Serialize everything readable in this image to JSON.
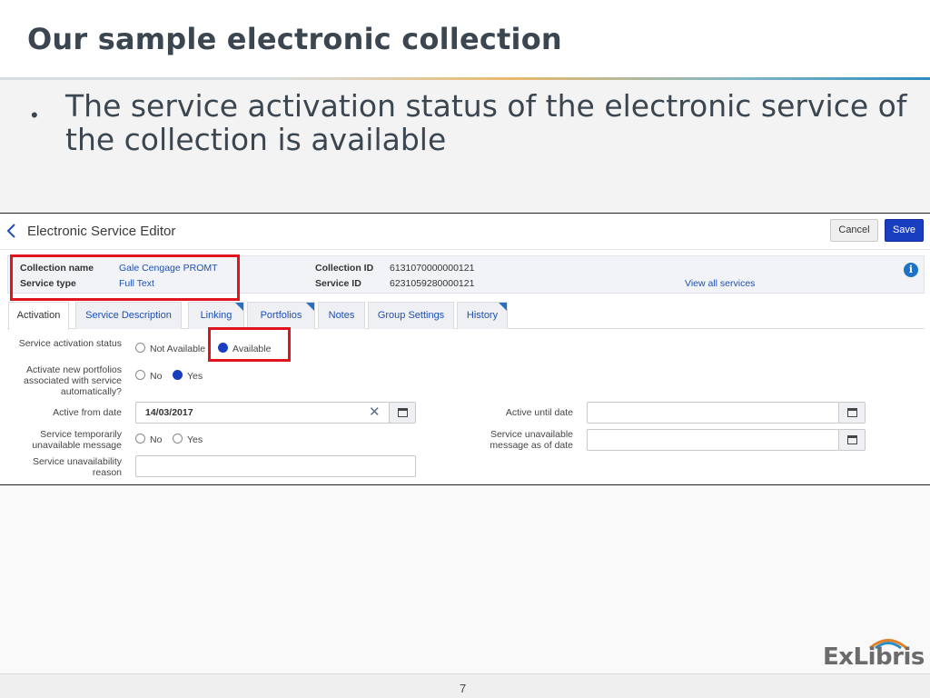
{
  "slide": {
    "title": "Our sample electronic collection",
    "bullet": "The service activation status of the electronic service of the collection is available",
    "page_number": "7",
    "logo_text": "ExLibris"
  },
  "editor": {
    "title": "Electronic Service Editor",
    "cancel_label": "Cancel",
    "save_label": "Save",
    "info": {
      "collection_name_label": "Collection name",
      "collection_name_value": "Gale Cengage PROMT",
      "service_type_label": "Service type",
      "service_type_value": "Full Text",
      "collection_id_label": "Collection ID",
      "collection_id_value": "6131070000000121",
      "service_id_label": "Service ID",
      "service_id_value": "6231059280000121",
      "view_all_link": "View all services",
      "info_icon": "i"
    },
    "tabs": [
      {
        "label": "Activation",
        "active": true
      },
      {
        "label": "Service Description",
        "active": false
      },
      {
        "label": "Linking",
        "active": false
      },
      {
        "label": "Portfolios",
        "active": false
      },
      {
        "label": "Notes",
        "active": false
      },
      {
        "label": "Group Settings",
        "active": false
      },
      {
        "label": "History",
        "active": false
      }
    ],
    "form": {
      "activation_status_label": "Service activation status",
      "activation_status_options": [
        "Not Available",
        "Available"
      ],
      "activation_status_selected": "Available",
      "activate_new_label": "Activate new portfolios associated with service automatically?",
      "activate_new_options": [
        "No",
        "Yes"
      ],
      "activate_new_selected": "Yes",
      "active_from_label": "Active from date",
      "active_from_value": "14/03/2017",
      "active_until_label": "Active until date",
      "active_until_value": "",
      "temp_unavailable_label": "Service temporarily unavailable message",
      "temp_unavailable_options": [
        "No",
        "Yes"
      ],
      "temp_unavailable_selected": "",
      "unavailable_as_of_label": "Service unavailable message as of date",
      "unavailable_as_of_value": "",
      "unavailability_reason_label": "Service unavailability reason",
      "unavailability_reason_value": ""
    }
  },
  "colors": {
    "accent_blue": "#1a3ec0",
    "link_blue": "#1e4fb4",
    "highlight_red": "#e0141e",
    "title_gray": "#3b4650"
  }
}
